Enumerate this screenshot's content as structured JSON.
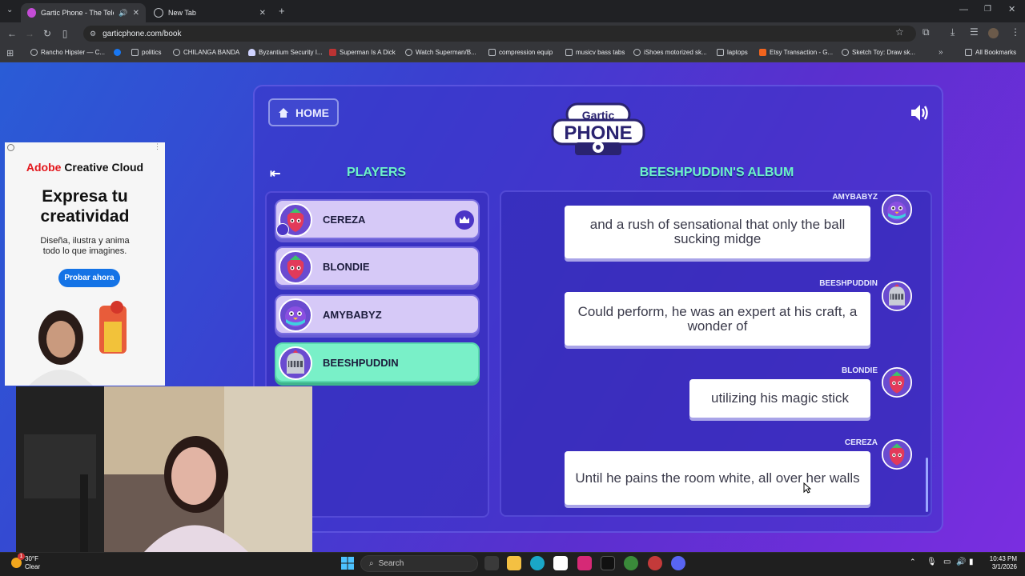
{
  "browser": {
    "tabs": [
      {
        "title": "Gartic Phone - The Telepho",
        "active": true
      },
      {
        "title": "New Tab",
        "active": false
      }
    ],
    "url": "garticphone.com/book",
    "bookmarks": [
      "Rancho Hipster — C...",
      "politics",
      "CHILANGA BANDA",
      "Byzantium Security I...",
      "Superman Is A Dick",
      "Watch Superman/B...",
      "compression equip",
      "musicv bass tabs",
      "iShoes motorized sk...",
      "laptops",
      "Etsy Transaction - G...",
      "Sketch Toy: Draw sk...",
      "All Bookmarks"
    ]
  },
  "game": {
    "home_label": "HOME",
    "logo_top": "Gartic",
    "logo_bottom": "PHONE",
    "players_heading": "PLAYERS",
    "album_heading": "BEESHPUDDIN'S ALBUM",
    "players": [
      {
        "name": "CEREZA",
        "host": true,
        "selected": false
      },
      {
        "name": "BLONDIE",
        "host": false,
        "selected": false
      },
      {
        "name": "AMYBABYZ",
        "host": false,
        "selected": false
      },
      {
        "name": "BEESHPUDDIN",
        "host": false,
        "selected": true
      }
    ],
    "album": [
      {
        "author": "AMYBABYZ",
        "text": "and a rush of sensational that only the ball sucking midge"
      },
      {
        "author": "BEESHPUDDIN",
        "text": "Could perform, he was an expert at his craft, a wonder of"
      },
      {
        "author": "BLONDIE",
        "text": "utilizing his magic stick"
      },
      {
        "author": "CEREZA",
        "text": "Until he pains the room white, all over her walls"
      }
    ]
  },
  "ad": {
    "brand_prefix": "Adobe",
    "brand_suffix": "Creative Cloud",
    "headline": "Expresa tu creatividad",
    "body": "Diseña, ilustra y anima todo lo que imagines.",
    "cta": "Probar ahora"
  },
  "taskbar": {
    "temperature": "30°F",
    "condition": "Clear",
    "search_placeholder": "Search",
    "time": "10:43 PM",
    "date": "3/1/2026",
    "notification_count": "1"
  },
  "colors": {
    "accent_mint": "#6df2c8",
    "player_card": "#d6c9f7",
    "player_selected": "#79f0c8",
    "adobe_red": "#e3161b",
    "adobe_blue": "#1473e6"
  }
}
